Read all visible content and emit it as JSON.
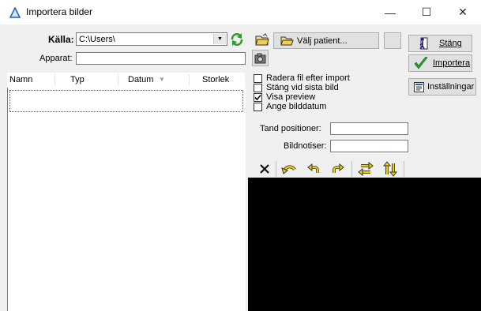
{
  "window": {
    "title": "Importera bilder",
    "minimize_glyph": "—",
    "maximize_glyph": "☐",
    "close_glyph": "✕"
  },
  "source": {
    "label": "Källa:",
    "value": "C:\\Users\\",
    "device_label": "Apparat:",
    "device_value": ""
  },
  "list": {
    "columns": [
      "Namn",
      "Typ",
      "Datum",
      "Storlek"
    ],
    "rows": []
  },
  "toolbar": {
    "choose_patient_label": "Välj patient...",
    "close_label": "Stäng",
    "import_label": "Importera",
    "settings_label": "Inställningar"
  },
  "options": {
    "delete_after_import": {
      "label": "Radera fil efter import",
      "checked": false
    },
    "close_on_last": {
      "label": "Stäng vid sista bild",
      "checked": false
    },
    "show_preview": {
      "label": "Visa preview",
      "checked": true
    },
    "set_date": {
      "label": "Ange bilddatum",
      "checked": false
    }
  },
  "fields": {
    "tooth_positions_label": "Tand positioner:",
    "tooth_positions_value": "",
    "notes_label": "Bildnotiser:",
    "notes_value": ""
  },
  "colors": {
    "accent_yellow": "#f0d000",
    "green": "#2a9d2a",
    "preview_bg": "#000000"
  },
  "icons": [
    "triangle-app-icon",
    "refresh-icon",
    "folder-open-icon",
    "camera-icon",
    "door-exit-icon",
    "checkmark-icon",
    "settings-icon",
    "delete-x-icon",
    "rotate-left-icon",
    "rotate-left-small-icon",
    "rotate-right-small-icon",
    "flip-horizontal-icon",
    "flip-vertical-icon"
  ]
}
